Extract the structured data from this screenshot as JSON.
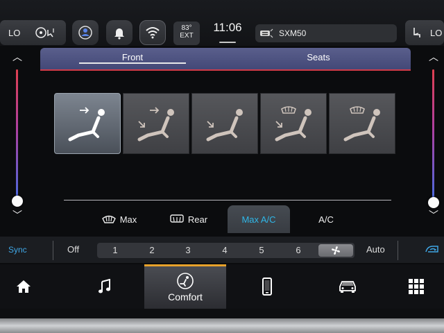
{
  "status": {
    "left_temp": "LO",
    "right_temp": "LO",
    "outside_temp": "83°",
    "outside_label": "EXT",
    "clock": "11:06",
    "radio_station": "SXM50"
  },
  "tabs": [
    {
      "label": "Front",
      "active": true
    },
    {
      "label": "Seats",
      "active": false
    }
  ],
  "seat_modes": [
    {
      "icon": "seat-face-vent-icon",
      "active": true
    },
    {
      "icon": "seat-face-feet-icon",
      "active": false
    },
    {
      "icon": "seat-feet-icon",
      "active": false
    },
    {
      "icon": "seat-defrost-feet-icon",
      "active": false
    },
    {
      "icon": "seat-defrost-icon",
      "active": false
    }
  ],
  "ac_buttons": {
    "max_defrost": "Max",
    "rear_defrost": "Rear",
    "max_ac": "Max A/C",
    "ac": "A/C"
  },
  "fan": {
    "sync": "Sync",
    "off": "Off",
    "levels": [
      "1",
      "2",
      "3",
      "4",
      "5",
      "6"
    ],
    "auto": "Auto"
  },
  "nav": {
    "comfort_label": "Comfort"
  },
  "colors": {
    "accent_blue": "#2fb7e8",
    "tab_underline": "#d03a48",
    "active_nav": "#e8a22a"
  }
}
